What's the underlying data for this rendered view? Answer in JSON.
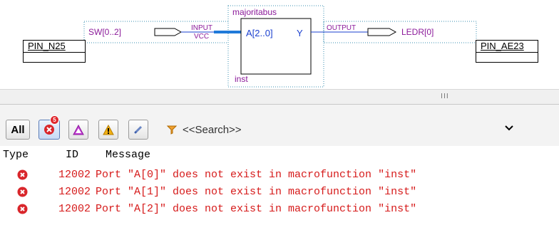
{
  "schematic": {
    "left_pin": {
      "label": "PIN_N25"
    },
    "right_pin": {
      "label": "PIN_AE23"
    },
    "input_signal": "SW[0..2]",
    "input_tag": "INPUT",
    "vcc_tag": "VCC",
    "block": {
      "name": "majoritabus",
      "port_in": "A[2..0]",
      "port_out": "Y",
      "instance": "inst"
    },
    "output_tag": "OUTPUT",
    "output_signal": "LEDR[0]",
    "colors": {
      "wire": "#1a3fcf",
      "label": "#8b1a9a",
      "bus": "#1f7ad9"
    }
  },
  "splitter": {
    "grip": "III"
  },
  "toolbar": {
    "all_label": "All",
    "error_count": "5",
    "buttons": [
      "error-filter-icon",
      "critical-warning-filter-icon",
      "warning-filter-icon",
      "suppressed-filter-icon"
    ],
    "search_placeholder": "<<Search>>"
  },
  "messages": {
    "columns": {
      "type": "Type",
      "id": "ID",
      "message": "Message"
    },
    "rows": [
      {
        "type": "error",
        "id": "12002",
        "text": "Port \"A[0]\" does not exist in macrofunction \"inst\""
      },
      {
        "type": "error",
        "id": "12002",
        "text": "Port \"A[1]\" does not exist in macrofunction \"inst\""
      },
      {
        "type": "error",
        "id": "12002",
        "text": "Port \"A[2]\" does not exist in macrofunction \"inst\""
      }
    ]
  }
}
